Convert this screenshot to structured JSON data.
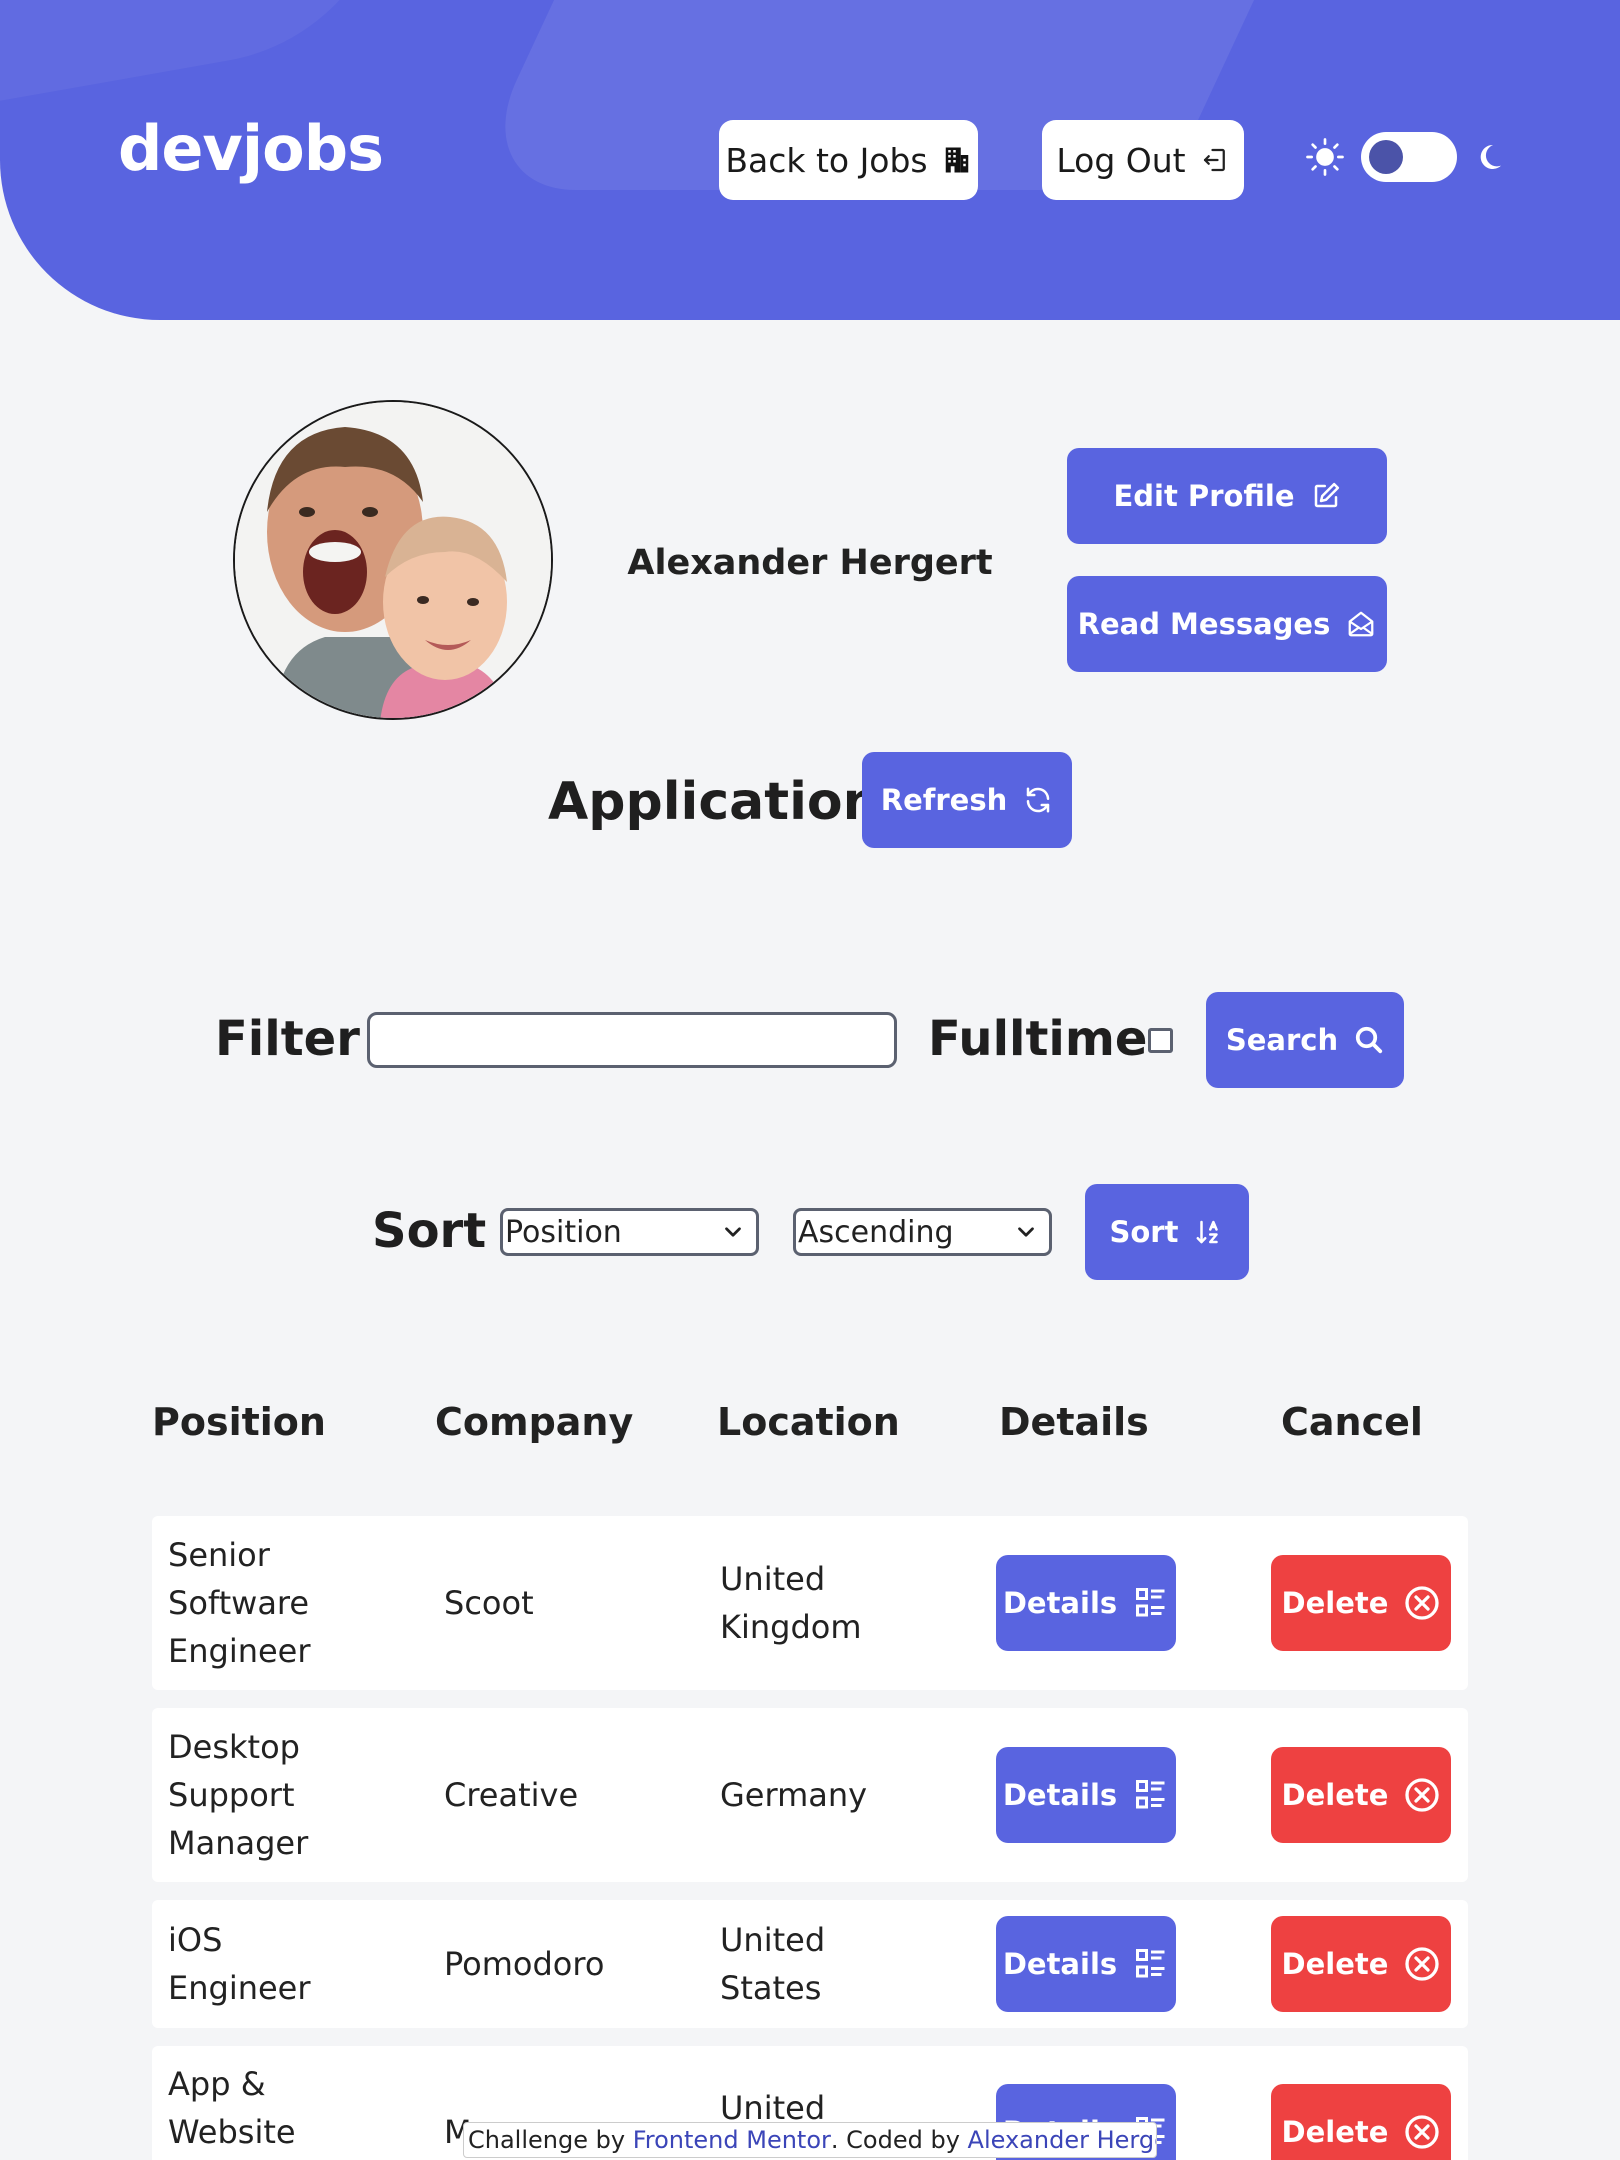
{
  "header": {
    "logo": "devjobs",
    "back_label": "Back to Jobs",
    "logout_label": "Log Out",
    "theme": {
      "sun_icon": "sun-icon",
      "moon_icon": "moon-icon",
      "dark_mode": false
    }
  },
  "profile": {
    "name": "Alexander Hergert",
    "edit_label": "Edit Profile",
    "messages_label": "Read Messages"
  },
  "applications": {
    "title": "Applications",
    "refresh_label": "Refresh"
  },
  "filter": {
    "label": "Filter",
    "input_value": "",
    "fulltime_label": "Fulltime",
    "fulltime_checked": false,
    "search_label": "Search"
  },
  "sort": {
    "label": "Sort",
    "field_selected": "Position",
    "order_selected": "Ascending",
    "button_label": "Sort"
  },
  "table": {
    "headers": [
      "Position",
      "Company",
      "Location",
      "Details",
      "Cancel"
    ],
    "details_label": "Details",
    "delete_label": "Delete",
    "rows": [
      {
        "position": [
          "Senior",
          "Software",
          "Engineer"
        ],
        "company": "Scoot",
        "location": [
          "United",
          "Kingdom"
        ]
      },
      {
        "position": [
          "Desktop",
          "Support",
          "Manager"
        ],
        "company": "Creative",
        "location": [
          "Germany"
        ]
      },
      {
        "position": [
          "iOS",
          "Engineer"
        ],
        "company": "Pomodoro",
        "location": [
          "United",
          "States"
        ]
      },
      {
        "position": [
          "App &",
          "Website"
        ],
        "company": "M",
        "location": [
          "United"
        ]
      }
    ]
  },
  "footer": {
    "prefix": "Challenge by ",
    "fm_link": "Frontend Mentor",
    "middle": ". Coded by ",
    "author_link": "Alexander Hergert",
    "suffix": "."
  },
  "colors": {
    "accent": "#5964e0",
    "danger": "#ee4141",
    "background": "#f4f5f7"
  }
}
